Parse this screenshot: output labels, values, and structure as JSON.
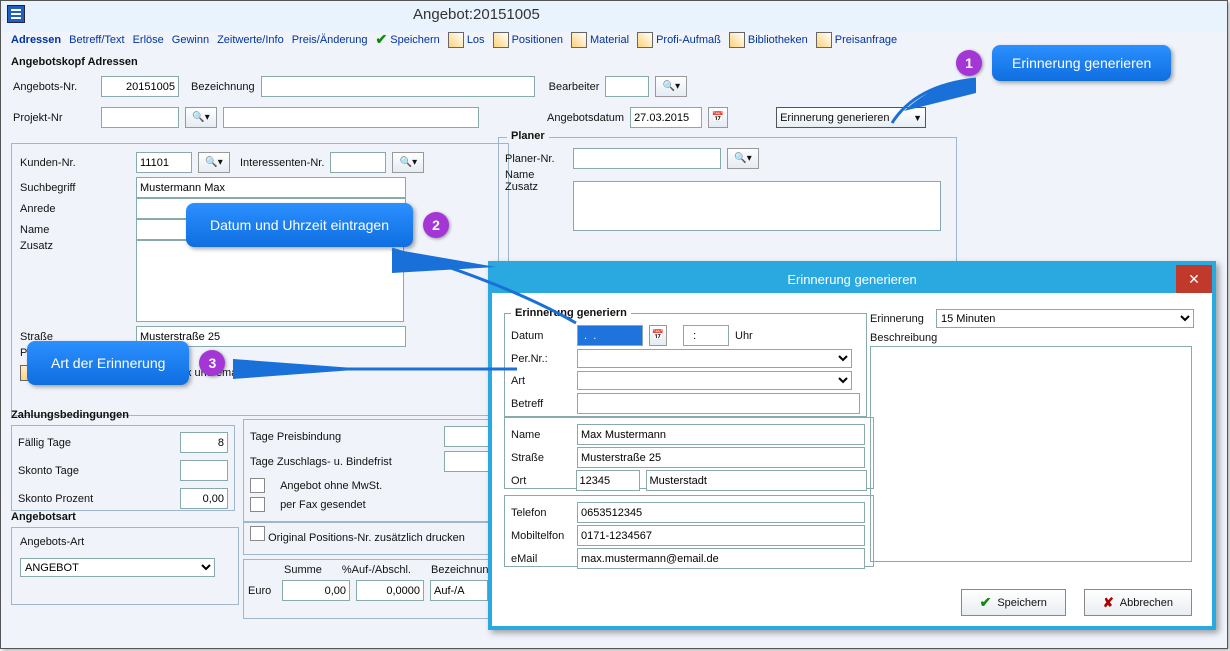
{
  "window": {
    "title": "Angebot:20151005"
  },
  "menu": {
    "adressen": "Adressen",
    "betreff": "Betreff/Text",
    "erloese": "Erlöse",
    "gewinn": "Gewinn",
    "zeitwerte": "Zeitwerte/Info",
    "preis": "Preis/Änderung",
    "speichern": "Speichern",
    "los": "Los",
    "positionen": "Positionen",
    "material": "Material",
    "profi": "Profi-Aufmaß",
    "bibliotheken": "Bibliotheken",
    "preisanfrage": "Preisanfrage"
  },
  "head": {
    "legend": "Angebotskopf Adressen",
    "angebots_nr_label": "Angebots-Nr.",
    "angebots_nr": "20151005",
    "bezeichnung_label": "Bezeichnung",
    "bezeichnung": "",
    "bearbeiter_label": "Bearbeiter",
    "bearbeiter": "",
    "projekt_label": "Projekt-Nr",
    "projekt": "",
    "angebotsdatum_label": "Angebotsdatum",
    "angebotsdatum": "27.03.2015",
    "erinnerung_btn": "Erinnerung generieren"
  },
  "kunde": {
    "kunden_nr_label": "Kunden-Nr.",
    "kunden_nr": "11101",
    "interessenten_label": "Interessenten-Nr.",
    "interessenten": "",
    "suchbegriff_label": "Suchbegriff",
    "suchbegriff": "Mustermann Max",
    "anrede_label": "Anrede",
    "anrede": "",
    "name_label": "Name",
    "name": "",
    "zusatz_label": "Zusatz",
    "zusatz": "",
    "strasse_label": "Straße",
    "strasse": "Musterstraße 25",
    "plz_label": "PLZ",
    "detail": "Detailansicht Telefon-Nr, Fax und email"
  },
  "planer": {
    "legend": "Planer",
    "planer_nr_label": "Planer-Nr.",
    "planer_nr": "",
    "name_label": "Name",
    "name": "",
    "zusatz_label": "Zusatz"
  },
  "zahlung": {
    "legend": "Zahlungsbedingungen",
    "faellig_label": "Fällig Tage",
    "faellig": "8",
    "skonto_tage_label": "Skonto Tage",
    "skonto_tage": "",
    "skonto_proz_label": "Skonto Prozent",
    "skonto_proz": "0,00",
    "tage_preis_label": "Tage Preisbindung",
    "tage_preis": "",
    "tage_zuschlag_label": "Tage Zuschlags- u. Bindefrist",
    "tage_zuschlag": "",
    "ohne_mwst": "Angebot ohne MwSt.",
    "per_fax": "per Fax gesendet",
    "origpos": "Original Positions-Nr.  zusätzlich drucken"
  },
  "art": {
    "legend": "Angebotsart",
    "label": "Angebots-Art",
    "value": "ANGEBOT"
  },
  "sum": {
    "summe": "Summe",
    "aufabschl": "%Auf-/Abschl.",
    "bezeich": "Bezeichnung",
    "euro": "Euro",
    "val1": "0,00",
    "val2": "0,0000",
    "val3": "Auf-/A"
  },
  "dialog": {
    "title": "Erinnerung generieren",
    "fieldset": "Erinnerung generiern",
    "datum_label": "Datum",
    "datum": " .  .    ",
    "uhr_suffix": "Uhr",
    "uhr_value": "  :  ",
    "erinnerung_label": "Erinnerung",
    "erinnerung_value": "15 Minuten",
    "pernr_label": "Per.Nr.:",
    "pernr": "",
    "art_label": "Art",
    "art": "",
    "betreff_label": "Betreff",
    "betreff": "",
    "beschreibung_label": "Beschreibung",
    "beschreibung": "",
    "name_label": "Name",
    "name": "Max Mustermann",
    "strasse_label": "Straße",
    "strasse": "Musterstraße 25",
    "ort_label": "Ort",
    "plz": "12345",
    "ort": "Musterstadt",
    "telefon_label": "Telefon",
    "telefon": "0653512345",
    "mobil_label": "Mobiltelfon",
    "mobil": "0171-1234567",
    "email_label": "eMail",
    "email": "max.mustermann@email.de",
    "speichern": "Speichern",
    "abbrechen": "Abbrechen"
  },
  "callouts": {
    "c1_num": "1",
    "c1_text": "Erinnerung generieren",
    "c2_num": "2",
    "c2_text": "Datum und Uhrzeit eintragen",
    "c3_num": "3",
    "c3_text": "Art der Erinnerung"
  }
}
